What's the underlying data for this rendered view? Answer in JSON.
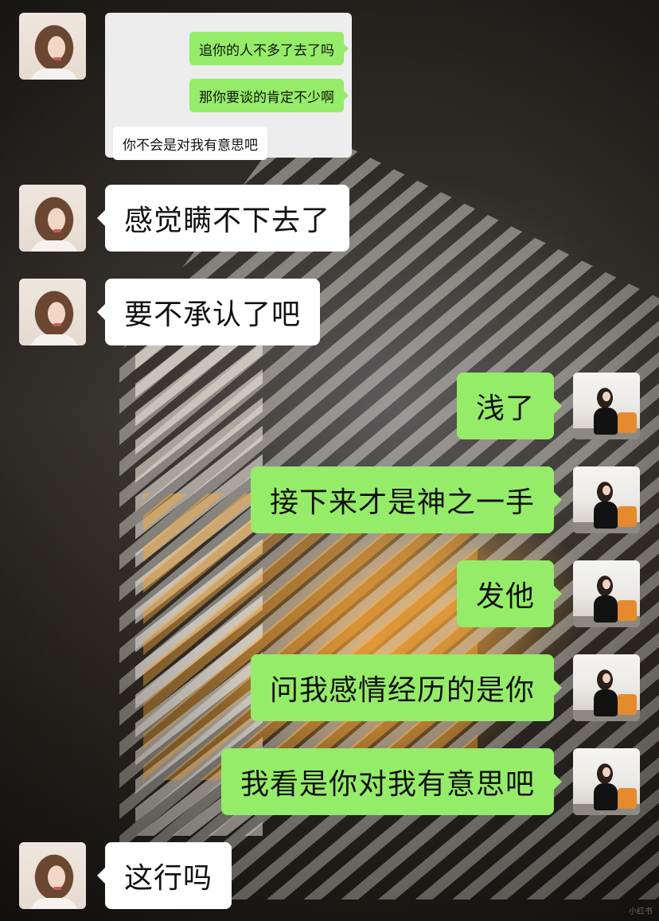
{
  "quoted_screenshot": {
    "messages": [
      {
        "side": "right",
        "text": "追你的人不多了去了吗"
      },
      {
        "side": "right",
        "text": "那你要谈的肯定不少啊"
      },
      {
        "side": "left",
        "text": "你不会是对我有意思吧"
      }
    ]
  },
  "messages": [
    {
      "side": "left",
      "text": "感觉瞒不下去了"
    },
    {
      "side": "left",
      "text": "要不承认了吧"
    },
    {
      "side": "right",
      "text": "浅了"
    },
    {
      "side": "right",
      "text": "接下来才是神之一手"
    },
    {
      "side": "right",
      "text": "发他"
    },
    {
      "side": "right",
      "text": "问我感情经历的是你"
    },
    {
      "side": "right",
      "text": "我看是你对我有意思吧"
    },
    {
      "side": "left",
      "text": "这行吗"
    }
  ],
  "watermark": "小红书",
  "colors": {
    "sent_bubble": "#95ec69",
    "received_bubble": "#ffffff"
  }
}
